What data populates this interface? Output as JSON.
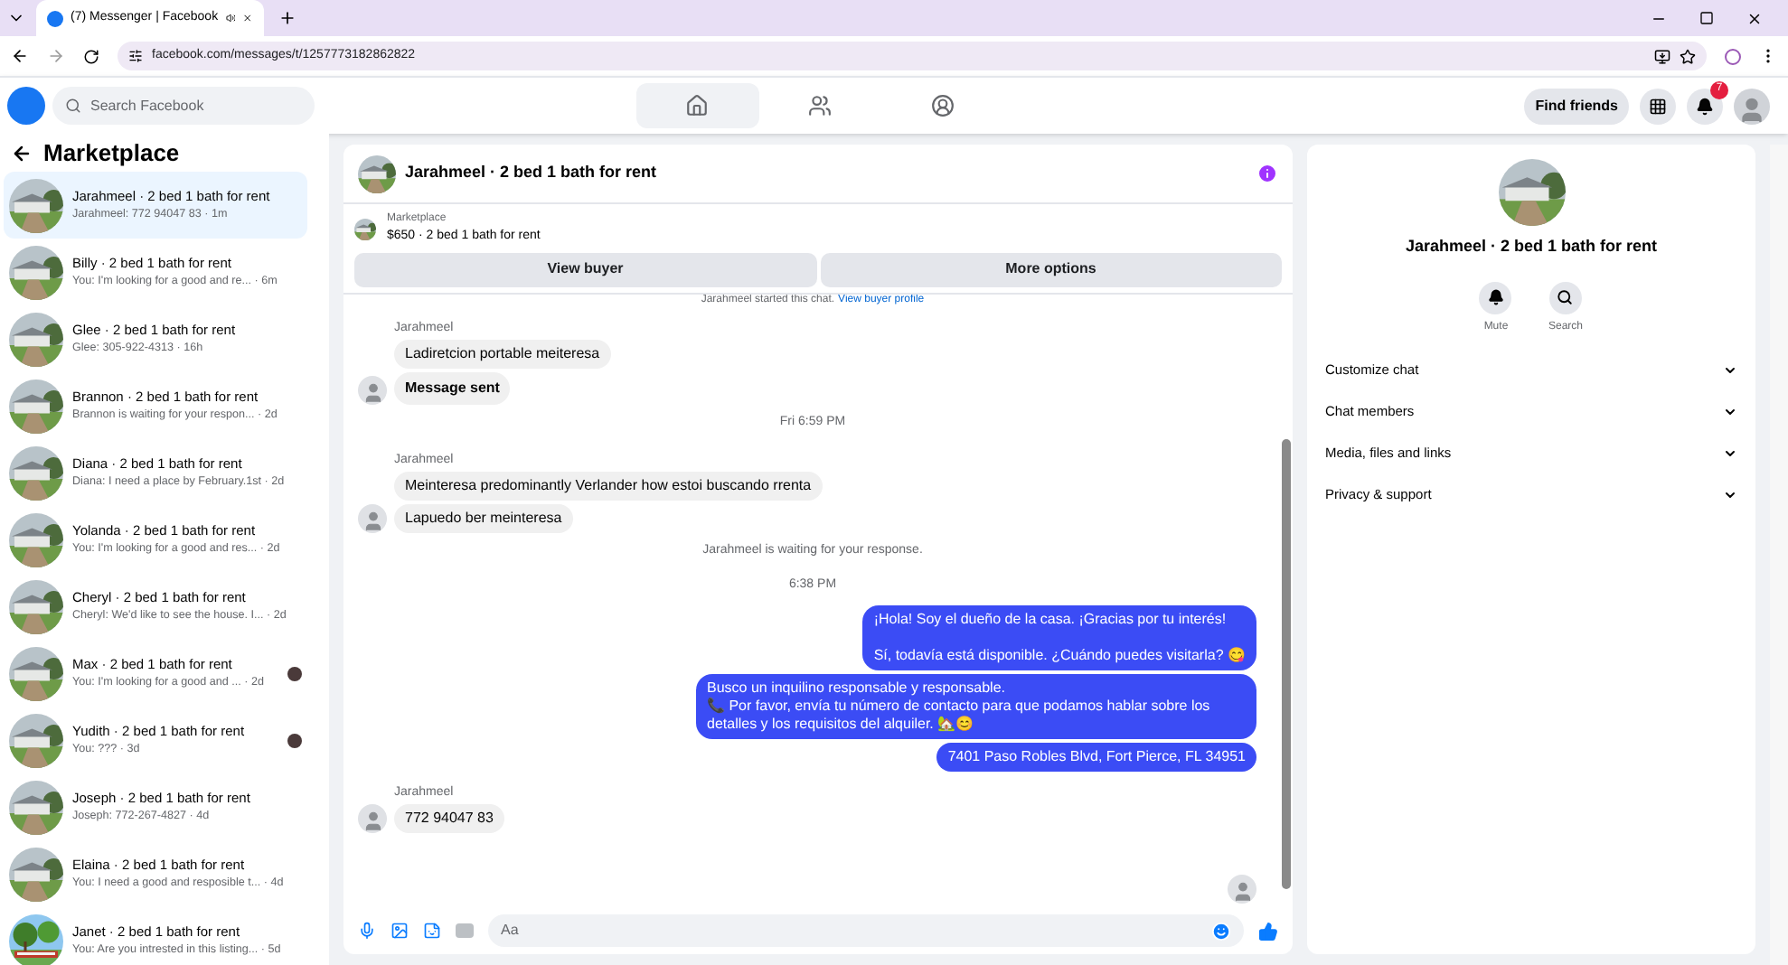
{
  "browser": {
    "tab_title": "(7) Messenger | Facebook",
    "url": "facebook.com/messages/t/1257773182862822"
  },
  "topbar": {
    "search_placeholder": "Search Facebook",
    "nav": [
      {
        "kind": "home",
        "selected": true
      },
      {
        "kind": "friends",
        "selected": false
      },
      {
        "kind": "groups",
        "selected": false
      }
    ],
    "find_friends": "Find friends",
    "notification_count": "7"
  },
  "sidebar": {
    "title": "Marketplace",
    "conversations": [
      {
        "name": "Jarahmeel · 2 bed 1 bath for rent",
        "preview": "Jarahmeel: 772 94047 83 · 1m",
        "selected": true,
        "seen": false,
        "kind": "house"
      },
      {
        "name": "Billy · 2 bed 1 bath for rent",
        "preview": "You: I'm looking for a good and re... · 6m",
        "selected": false,
        "seen": false,
        "kind": "house"
      },
      {
        "name": "Glee · 2 bed 1 bath for rent",
        "preview": "Glee: 305-922-4313 · 16h",
        "selected": false,
        "seen": false,
        "kind": "house"
      },
      {
        "name": "Brannon · 2 bed 1 bath for rent",
        "preview": "Brannon is waiting for your respon... · 2d",
        "selected": false,
        "seen": false,
        "kind": "house"
      },
      {
        "name": "Diana · 2 bed 1 bath for rent",
        "preview": "Diana: I need a place by February.1st · 2d",
        "selected": false,
        "seen": false,
        "kind": "house"
      },
      {
        "name": "Yolanda · 2 bed 1 bath for rent",
        "preview": "You: I'm looking for a good and res... · 2d",
        "selected": false,
        "seen": false,
        "kind": "house"
      },
      {
        "name": "Cheryl · 2 bed 1 bath for rent",
        "preview": "Cheryl: We'd like to see the house. I... · 2d",
        "selected": false,
        "seen": false,
        "kind": "house"
      },
      {
        "name": "Max · 2 bed 1 bath for rent",
        "preview": "You: I'm looking for a good and ... · 2d",
        "selected": false,
        "seen": true,
        "kind": "house"
      },
      {
        "name": "Yudith · 2 bed 1 bath for rent",
        "preview": "You: ??? · 3d",
        "selected": false,
        "seen": true,
        "kind": "house"
      },
      {
        "name": "Joseph · 2 bed 1 bath for rent",
        "preview": "Joseph: 772-267-4827 · 4d",
        "selected": false,
        "seen": false,
        "kind": "house"
      },
      {
        "name": "Elaina · 2 bed 1 bath for rent",
        "preview": "You: I need a good and resposible t... · 4d",
        "selected": false,
        "seen": false,
        "kind": "house"
      },
      {
        "name": "Janet · 2 bed 1 bath for rent",
        "preview": "You: Are you intrested in this listing... · 5d",
        "selected": false,
        "seen": false,
        "kind": "trees"
      }
    ]
  },
  "chat": {
    "title": "Jarahmeel · 2 bed 1 bath for rent",
    "listing_label": "Marketplace",
    "listing_title": "$650 · 2 bed 1 bath for rent",
    "buttons": [
      "View buyer",
      "More options"
    ],
    "started": "Jarahmeel started this chat.",
    "started_link": "View buyer profile",
    "messages": [
      {
        "kind": "sender",
        "text": "Jarahmeel"
      },
      {
        "kind": "incoming",
        "text": "Ladiretcion portable meiteresa",
        "bold": false,
        "avatar": false
      },
      {
        "kind": "incoming",
        "text": "Message sent",
        "bold": true,
        "avatar": true
      },
      {
        "kind": "time",
        "text": "Fri 6:59 PM"
      },
      {
        "kind": "sender",
        "text": "Jarahmeel"
      },
      {
        "kind": "incoming",
        "text": "Meinteresa predominantly Verlander how estoi buscando rrenta",
        "bold": false,
        "avatar": false
      },
      {
        "kind": "incoming",
        "text": "Lapuedo ber meinteresa",
        "bold": false,
        "avatar": true
      },
      {
        "kind": "notice",
        "text": "Jarahmeel is waiting for your response."
      },
      {
        "kind": "time",
        "text": "6:38 PM"
      },
      {
        "kind": "outgoing",
        "paragraphs": [
          [
            "¡Hola! Soy el dueño de la casa. ¡Gracias por tu interés!"
          ],
          [
            "Sí, todavía está disponible. ¿Cuándo puedes visitarla? 😋"
          ]
        ]
      },
      {
        "kind": "outgoing",
        "paragraphs": [
          [
            "Busco un inquilino responsable y responsable.",
            "📞 Por favor, envía tu número de contacto para que podamos hablar sobre los detalles y los requisitos del alquiler. 🏡😊"
          ]
        ]
      },
      {
        "kind": "outgoing",
        "paragraphs": [
          [
            "7401 Paso Robles Blvd, Fort Pierce, FL 34951"
          ]
        ]
      },
      {
        "kind": "sender",
        "text": "Jarahmeel"
      },
      {
        "kind": "incoming",
        "text": "772 94047 83",
        "bold": false,
        "avatar": true
      }
    ],
    "composer_placeholder": "Aa"
  },
  "info": {
    "title": "Jarahmeel · 2 bed 1 bath for rent",
    "actions": [
      {
        "kind": "mute",
        "label": "Mute"
      },
      {
        "kind": "search",
        "label": "Search"
      }
    ],
    "sections": [
      {
        "label": "Customize chat",
        "expanded": false
      },
      {
        "label": "Chat members",
        "expanded": false
      },
      {
        "label": "Media, files and links",
        "expanded": false
      },
      {
        "label": "Privacy & support",
        "expanded": false
      }
    ]
  }
}
